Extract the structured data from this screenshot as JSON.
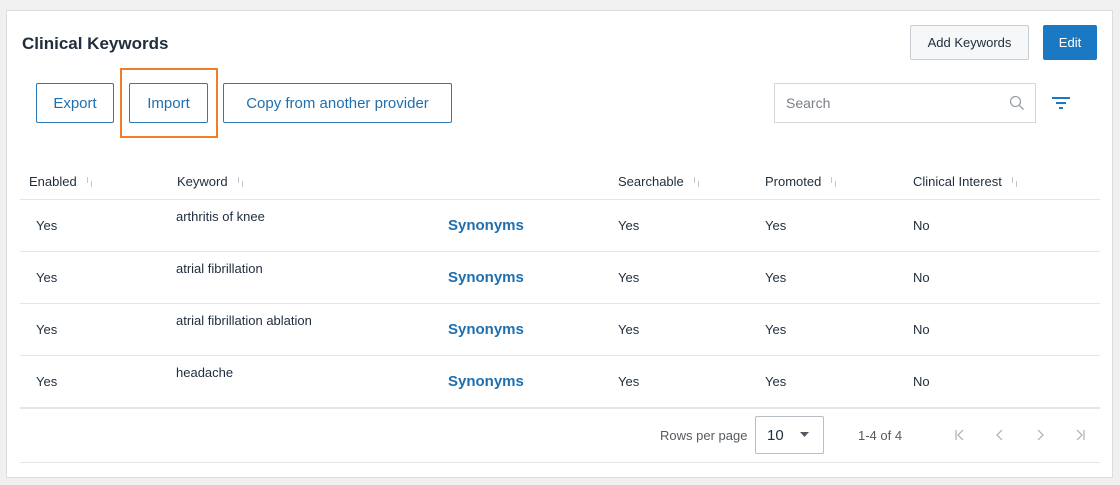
{
  "header": {
    "title": "Clinical Keywords",
    "add_label": "Add Keywords",
    "edit_label": "Edit"
  },
  "toolbar": {
    "export_label": "Export",
    "import_label": "Import",
    "copy_label": "Copy from another provider",
    "search_placeholder": "Search"
  },
  "table": {
    "columns": {
      "enabled": "Enabled",
      "keyword": "Keyword",
      "searchable": "Searchable",
      "promoted": "Promoted",
      "clinical_interest": "Clinical Interest"
    },
    "rows": [
      {
        "enabled": "Yes",
        "keyword": "arthritis of knee",
        "synonyms": "Synonyms",
        "searchable": "Yes",
        "promoted": "Yes",
        "clinical_interest": "No"
      },
      {
        "enabled": "Yes",
        "keyword": "atrial fibrillation",
        "synonyms": "Synonyms",
        "searchable": "Yes",
        "promoted": "Yes",
        "clinical_interest": "No"
      },
      {
        "enabled": "Yes",
        "keyword": "atrial fibrillation ablation",
        "synonyms": "Synonyms",
        "searchable": "Yes",
        "promoted": "Yes",
        "clinical_interest": "No"
      },
      {
        "enabled": "Yes",
        "keyword": "headache",
        "synonyms": "Synonyms",
        "searchable": "Yes",
        "promoted": "Yes",
        "clinical_interest": "No"
      }
    ]
  },
  "pagination": {
    "rows_per_page_label": "Rows per page",
    "rows_per_page_value": "10",
    "range_text": "1-4 of 4"
  },
  "colors": {
    "primary": "#1a79c2",
    "link": "#1f6fae",
    "highlight": "#f07d2a"
  },
  "icons": [
    "search-icon",
    "filter-icon",
    "sort-icon",
    "chevron-down-icon",
    "first-page-icon",
    "previous-page-icon",
    "next-page-icon",
    "last-page-icon"
  ]
}
